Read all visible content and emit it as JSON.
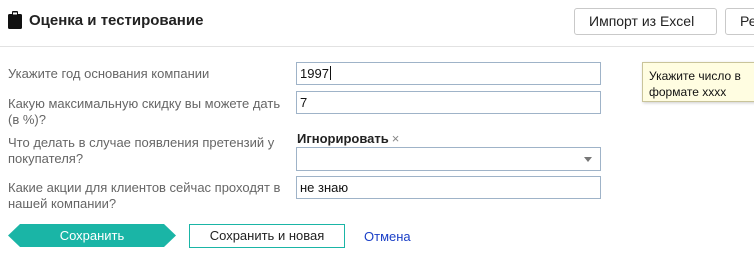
{
  "header": {
    "title": "Оценка и тестирование",
    "import_label": "Импорт из Excel",
    "re_label": "Ре"
  },
  "form": {
    "fields": [
      {
        "label": "Укажите год основания компании",
        "value": "1997"
      },
      {
        "label": "Какую максимальную скидку вы можете дать (в %)?",
        "value": "7"
      },
      {
        "label": "Что делать в случае появления претензий у покупателя?",
        "tag": "Игнорировать",
        "tag_remove": "×",
        "value": ""
      },
      {
        "label": "Какие акции для клиентов сейчас проходят в нашей компании?",
        "value": "не знаю"
      }
    ],
    "tooltip": "Укажите число в формате хххх"
  },
  "actions": {
    "save_label": "Сохранить",
    "save_new_label": "Сохранить и новая",
    "cancel_label": "Отмена"
  },
  "colors": {
    "accent": "#1ab5a6",
    "link": "#1a3fc7",
    "tooltip_bg": "#fffde1"
  },
  "icons": {
    "title_icon": "clipboard-icon",
    "select_icon": "chevron-down-icon"
  }
}
